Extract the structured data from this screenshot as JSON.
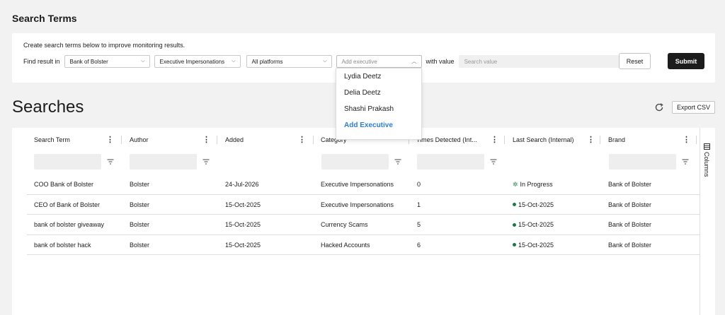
{
  "page_title": "Search Terms",
  "terms": {
    "description": "Create search terms below to improve monitoring results.",
    "find_label": "Find result in",
    "brand_select": "Bank of Bolster",
    "category_select": "Executive Impersonations",
    "platform_select": "All platforms",
    "executive_placeholder": "Add executive",
    "with_value_label": "with value",
    "search_value_placeholder": "Search value",
    "reset_label": "Reset",
    "submit_label": "Submit"
  },
  "executive_dropdown": {
    "options": [
      "Lydia Deetz",
      "Delia Deetz",
      "Shashi Prakash"
    ],
    "add_label": "Add Executive"
  },
  "searches": {
    "title": "Searches",
    "export_label": "Export CSV",
    "columns_label": "Columns",
    "columns": [
      "Search Term",
      "Author",
      "Added",
      "Category",
      "Times Detected (Int...",
      "Last Search (Internal)",
      "Brand"
    ],
    "rows": [
      {
        "term": "COO Bank of Bolster",
        "author": "Bolster",
        "added": "24-Jul-2026",
        "category": "Executive Impersonations",
        "times": "0",
        "last": "In Progress",
        "status": "in-progress",
        "brand": "Bank of Bolster"
      },
      {
        "term": "CEO of Bank of Bolster",
        "author": "Bolster",
        "added": "15-Oct-2025",
        "category": "Executive Impersonations",
        "times": "1",
        "last": "15-Oct-2025",
        "status": "done",
        "brand": "Bank of Bolster"
      },
      {
        "term": "bank of bolster giveaway",
        "author": "Bolster",
        "added": "15-Oct-2025",
        "category": "Currency Scams",
        "times": "5",
        "last": "15-Oct-2025",
        "status": "done",
        "brand": "Bank of Bolster"
      },
      {
        "term": "bank of bolster hack",
        "author": "Bolster",
        "added": "15-Oct-2025",
        "category": "Hacked Accounts",
        "times": "6",
        "last": "15-Oct-2025",
        "status": "done",
        "brand": "Bank of Bolster"
      }
    ]
  },
  "colors": {
    "accent_link": "#2a7de1",
    "status_green": "#1c7a4a",
    "submit_bg": "#1c1c1c"
  }
}
